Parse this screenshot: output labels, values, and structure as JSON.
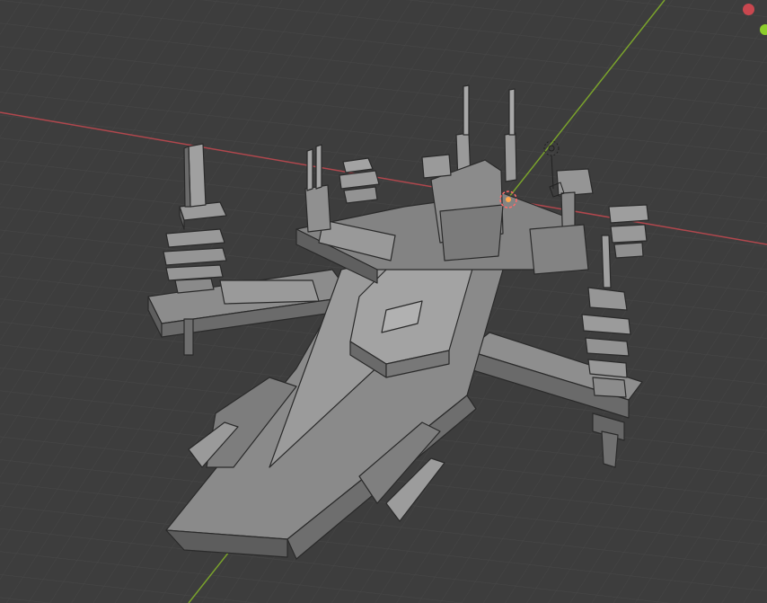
{
  "app": {
    "name": "",
    "view": "3D Viewport"
  },
  "viewport": {
    "background_color": "#3d3d3d",
    "grid_color": "#4a4a4a",
    "x_axis_color": "#b0474d",
    "y_axis_color": "#7aa22c",
    "model_name": "",
    "shading": "solid"
  },
  "gizmo": {
    "x_color": "#c9474f",
    "y_color": "#8ccd2a"
  },
  "markers": {
    "origin_icon": "3d-cursor-icon",
    "light_icon": "light-icon",
    "camera_icon": "camera-icon"
  }
}
